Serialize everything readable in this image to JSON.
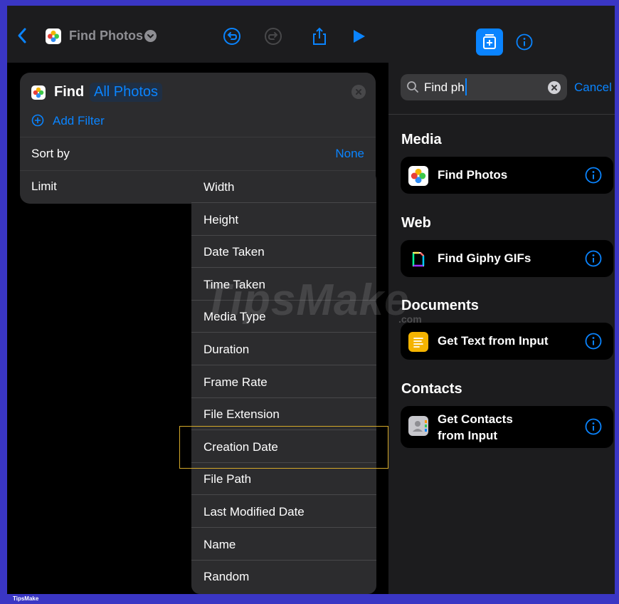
{
  "toolbar": {
    "title": "Find Photos"
  },
  "card": {
    "find_label": "Find",
    "find_target": "All Photos",
    "add_filter": "Add Filter",
    "sort_by_label": "Sort by",
    "sort_by_value": "None",
    "limit_label": "Limit"
  },
  "menu": {
    "items": [
      "Width",
      "Height",
      "Date Taken",
      "Time Taken",
      "Media Type",
      "Duration",
      "Frame Rate",
      "File Extension",
      "Creation Date",
      "File Path",
      "Last Modified Date",
      "Name",
      "Random"
    ],
    "highlighted": "Creation Date"
  },
  "search": {
    "value": "Find ph",
    "cancel_label": "Cancel"
  },
  "sections": {
    "media": "Media",
    "web": "Web",
    "documents": "Documents",
    "contacts": "Contacts"
  },
  "results": {
    "find_photos": "Find Photos",
    "find_giphy": "Find Giphy GIFs",
    "get_text": "Get Text from Input",
    "get_contacts_1": "Get Contacts",
    "get_contacts_2": "from Input"
  },
  "watermark": {
    "text": "TipsMake",
    "sub": ".com"
  },
  "footer": {
    "brand": "TipsMake"
  },
  "colors": {
    "accent": "#0a84ff",
    "highlight_border": "#d4a92a",
    "frame": "#3a36c4"
  }
}
